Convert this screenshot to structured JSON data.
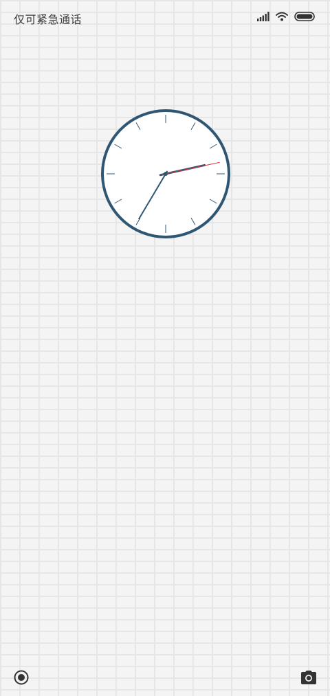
{
  "status_bar": {
    "carrier_text": "仅可紧急通话",
    "icons": [
      "signal-icon",
      "wifi-icon",
      "battery-icon"
    ]
  },
  "clock": {
    "hour": 2,
    "minute": 35,
    "second": 7,
    "face_color": "#ffffff",
    "rim_color": "#2f5673",
    "hand_color": "#2f5673",
    "second_hand_color": "#e0333a"
  },
  "bottom_bar": {
    "left_icon": "target-icon",
    "right_icon": "camera-icon"
  }
}
